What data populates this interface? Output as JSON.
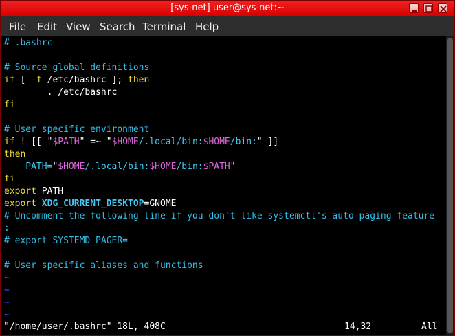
{
  "window": {
    "title": "[sys-net] user@sys-net:~",
    "buttons": [
      "minimize",
      "maximize",
      "close"
    ]
  },
  "menu": [
    "File",
    "Edit",
    "View",
    "Search",
    "Terminal",
    "Help"
  ],
  "lines": [
    [
      {
        "t": "# .bashrc",
        "c": "comment"
      }
    ],
    [],
    [
      {
        "t": "# Source global definitions",
        "c": "comment"
      }
    ],
    [
      {
        "t": "if",
        "c": "kw"
      },
      {
        "t": " [ ",
        "c": "text"
      },
      {
        "t": "-f",
        "c": "kw"
      },
      {
        "t": " /etc/bashrc ]; ",
        "c": "text"
      },
      {
        "t": "then",
        "c": "kw"
      }
    ],
    [
      {
        "t": "        . /etc/bashrc",
        "c": "text"
      }
    ],
    [
      {
        "t": "fi",
        "c": "kw"
      }
    ],
    [],
    [
      {
        "t": "# User specific environment",
        "c": "comment"
      }
    ],
    [
      {
        "t": "if",
        "c": "kw"
      },
      {
        "t": " ! [[ ",
        "c": "text"
      },
      {
        "t": "\"",
        "c": "text"
      },
      {
        "t": "$PATH",
        "c": "str"
      },
      {
        "t": "\"",
        "c": "text"
      },
      {
        "t": " =~ ",
        "c": "text"
      },
      {
        "t": "\"",
        "c": "text"
      },
      {
        "t": "$HOME",
        "c": "str"
      },
      {
        "t": "/.local/bin:",
        "c": "var"
      },
      {
        "t": "$HOME",
        "c": "str"
      },
      {
        "t": "/bin:",
        "c": "var"
      },
      {
        "t": "\"",
        "c": "text"
      },
      {
        "t": " ]]",
        "c": "text"
      }
    ],
    [
      {
        "t": "then",
        "c": "kw"
      }
    ],
    [
      {
        "t": "    PATH=",
        "c": "var"
      },
      {
        "t": "\"",
        "c": "text"
      },
      {
        "t": "$HOME",
        "c": "str"
      },
      {
        "t": "/.local/bin:",
        "c": "var"
      },
      {
        "t": "$HOME",
        "c": "str"
      },
      {
        "t": "/bin:",
        "c": "var"
      },
      {
        "t": "$PATH",
        "c": "str"
      },
      {
        "t": "\"",
        "c": "text"
      }
    ],
    [
      {
        "t": "fi",
        "c": "kw"
      }
    ],
    [
      {
        "t": "export",
        "c": "kw"
      },
      {
        "t": " PATH",
        "c": "text"
      }
    ],
    [
      {
        "t": "export",
        "c": "kw"
      },
      {
        "t": " ",
        "c": "text"
      },
      {
        "t": "XDG_CURRENT_DESKTOP",
        "c": "bold"
      },
      {
        "t": "=GNOME",
        "c": "text"
      }
    ],
    [
      {
        "t": "# Uncomment the following line if you don't like systemctl's auto-paging feature",
        "c": "comment"
      }
    ],
    [
      {
        "t": ":",
        "c": "comment"
      }
    ],
    [
      {
        "t": "# export SYSTEMD_PAGER=",
        "c": "comment"
      }
    ],
    [],
    [
      {
        "t": "# User specific aliases and functions",
        "c": "comment"
      }
    ],
    [
      {
        "t": "~",
        "c": "tilde"
      }
    ],
    [
      {
        "t": "~",
        "c": "tilde"
      }
    ],
    [
      {
        "t": "~",
        "c": "tilde"
      }
    ],
    [
      {
        "t": "~",
        "c": "tilde"
      }
    ]
  ],
  "status": {
    "file": "\"/home/user/.bashrc\" 18L, 408C",
    "position": "14,32",
    "scroll": "All"
  }
}
